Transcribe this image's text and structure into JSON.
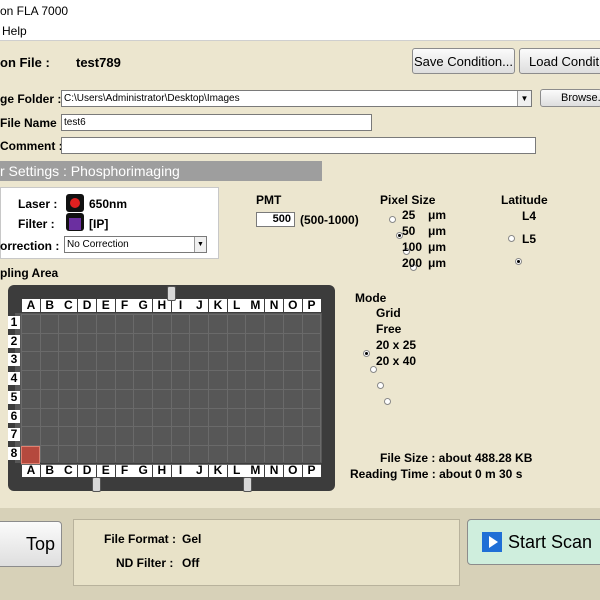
{
  "window": {
    "title": "on FLA 7000"
  },
  "menu": {
    "help": "Help"
  },
  "header": {
    "condition_label": "on File :",
    "condition_value": "test789",
    "save_button": "Save Condition...",
    "load_button": "Load Condition"
  },
  "form": {
    "folder_label": "ge Folder :",
    "folder_value": "C:\\Users\\Administrator\\Desktop\\Images",
    "browse_button": "Browse...",
    "file_label": "File Name :",
    "file_value": "test6",
    "comment_label": "Comment :",
    "comment_value": ""
  },
  "section": {
    "title": "r Settings : Phosphorimaging"
  },
  "laser": {
    "laser_label": "Laser :",
    "laser_value": "650nm",
    "filter_label": "Filter :",
    "filter_value": "[IP]",
    "correction_label": "orrection :",
    "correction_value": "No Correction",
    "laser_icon_color": "#e02020",
    "filter_icon_color": "#6b2fa0"
  },
  "pmt": {
    "title": "PMT",
    "value": "500",
    "range": "(500-1000)"
  },
  "pixel": {
    "title": "Pixel Size",
    "options": [
      {
        "value": "25",
        "unit": "μm",
        "selected": false
      },
      {
        "value": "50",
        "unit": "μm",
        "selected": true
      },
      {
        "value": "100",
        "unit": "μm",
        "selected": false
      },
      {
        "value": "200",
        "unit": "μm",
        "selected": false
      }
    ]
  },
  "latitude": {
    "title": "Latitude",
    "options": [
      {
        "value": "L4",
        "selected": false
      },
      {
        "value": "L5",
        "selected": true
      }
    ]
  },
  "sampling": {
    "title": "pling Area",
    "columns": [
      "A",
      "B",
      "C",
      "D",
      "E",
      "F",
      "G",
      "H",
      "I",
      "J",
      "K",
      "L",
      "M",
      "N",
      "O",
      "P"
    ],
    "rows": [
      "1",
      "2",
      "3",
      "4",
      "5",
      "6",
      "7",
      "8"
    ],
    "selected_cell": {
      "col": "A",
      "row": "8"
    },
    "selection_color": "#b5493e"
  },
  "mode": {
    "title": "Mode",
    "options": [
      {
        "label": "Grid",
        "selected": true
      },
      {
        "label": "Free",
        "selected": false
      },
      {
        "label": "20 x 25",
        "selected": false
      },
      {
        "label": "20 x 40",
        "selected": false
      }
    ]
  },
  "info": {
    "file_size_label": "File Size : about",
    "file_size_value": "488.28 KB",
    "reading_time_label": "Reading Time : about",
    "reading_time_value": "0 m 30 s"
  },
  "bottom": {
    "top_button": "Top",
    "file_format_label": "File Format :",
    "file_format_value": "Gel",
    "nd_filter_label": "ND Filter :",
    "nd_filter_value": "Off",
    "start_button": "Start Scan",
    "start_icon_color": "#1f6fd6",
    "start_button_color": "#cfeedd"
  }
}
